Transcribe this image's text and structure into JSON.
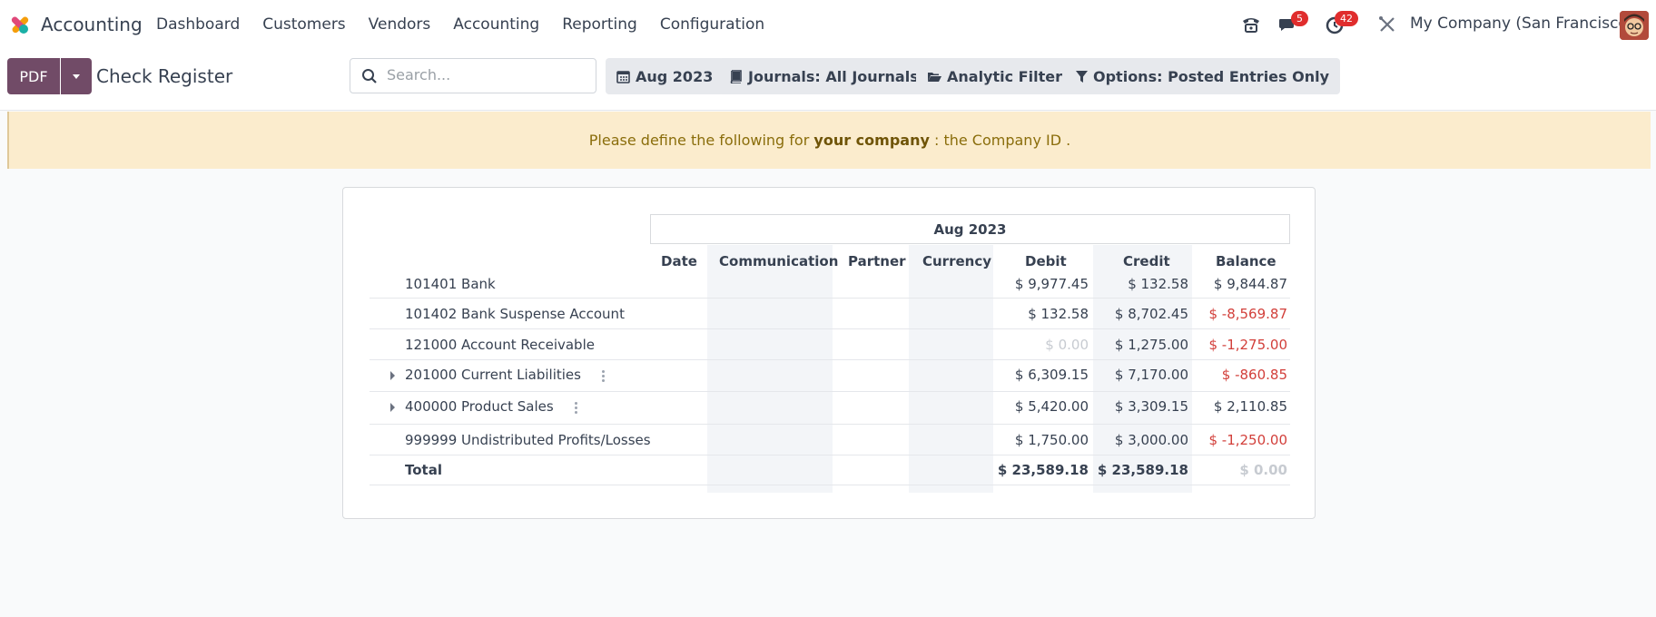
{
  "navbar": {
    "app_name": "Accounting",
    "menu": [
      "Dashboard",
      "Customers",
      "Vendors",
      "Accounting",
      "Reporting",
      "Configuration"
    ],
    "messages_badge": "5",
    "activities_badge": "42",
    "company": "My Company (San Francisco)"
  },
  "control": {
    "pdf_label": "PDF",
    "title": "Check Register",
    "search_placeholder": "Search...",
    "date_filter": "Aug 2023",
    "journals_filter": "Journals: All Journals",
    "analytic_filter": "Analytic Filter",
    "options_filter": "Options: Posted Entries Only"
  },
  "warning": {
    "prefix": "Please define the following for ",
    "company": "your company",
    "suffix": " : the Company ID ."
  },
  "report": {
    "period": "Aug 2023",
    "columns": [
      "Date",
      "Communication",
      "Partner",
      "Currency",
      "Debit",
      "Credit",
      "Balance"
    ],
    "rows": [
      {
        "name": "101401 Bank",
        "debit": "$ 9,977.45",
        "credit": "$ 132.58",
        "balance": "$ 9,844.87"
      },
      {
        "name": "101402 Bank Suspense Account",
        "debit": "$ 132.58",
        "credit": "$ 8,702.45",
        "balance": "$ -8,569.87"
      },
      {
        "name": "121000 Account Receivable",
        "debit": "$ 0.00",
        "credit": "$ 1,275.00",
        "balance": "$ -1,275.00"
      },
      {
        "name": "201000 Current Liabilities",
        "debit": "$ 6,309.15",
        "credit": "$ 7,170.00",
        "balance": "$ -860.85"
      },
      {
        "name": "400000 Product Sales",
        "debit": "$ 5,420.00",
        "credit": "$ 3,309.15",
        "balance": "$ 2,110.85"
      },
      {
        "name": "999999 Undistributed Profits/Losses",
        "debit": "$ 1,750.00",
        "credit": "$ 3,000.00",
        "balance": "$ -1,250.00"
      }
    ],
    "total": {
      "name": "Total",
      "debit": "$ 23,589.18",
      "credit": "$ 23,589.18",
      "balance": "$ 0.00"
    }
  },
  "colors": {
    "brand": "#714b67",
    "negative": "#d23f3a",
    "warning_bg": "#fbeccd"
  }
}
